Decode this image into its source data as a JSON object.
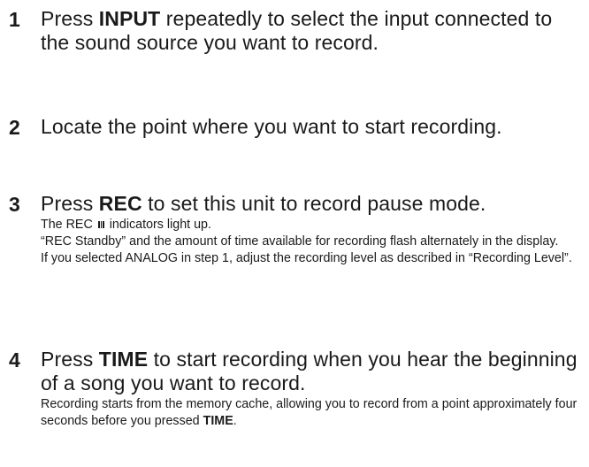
{
  "steps": [
    {
      "number": "1",
      "pre": "Press ",
      "key": "INPUT",
      "post": " repeatedly to select the input connected to the sound source you want to record."
    },
    {
      "number": "2",
      "text": "Locate the point where you want to start recording."
    },
    {
      "number": "3",
      "pre": "Press ",
      "key": "REC",
      "post": " to set this unit to record pause mode.",
      "detail": {
        "line1_pre": "The REC ",
        "pause_icon": "pause-icon",
        "line1_post": " indicators light up.",
        "line2": "“REC Standby” and the amount of time available for recording flash alternately in the display.",
        "line3": "If you selected ANALOG in step 1, adjust the recording level as described in “Recording Level”."
      }
    },
    {
      "number": "4",
      "pre": "Press ",
      "key": "TIME",
      "post": " to start recording when you hear the beginning of a song you want to record.",
      "detail": {
        "text_pre": "Recording starts from the memory cache, allowing you to record from a point approximately four seconds before you pressed ",
        "text_key": "TIME",
        "text_post": "."
      }
    }
  ]
}
